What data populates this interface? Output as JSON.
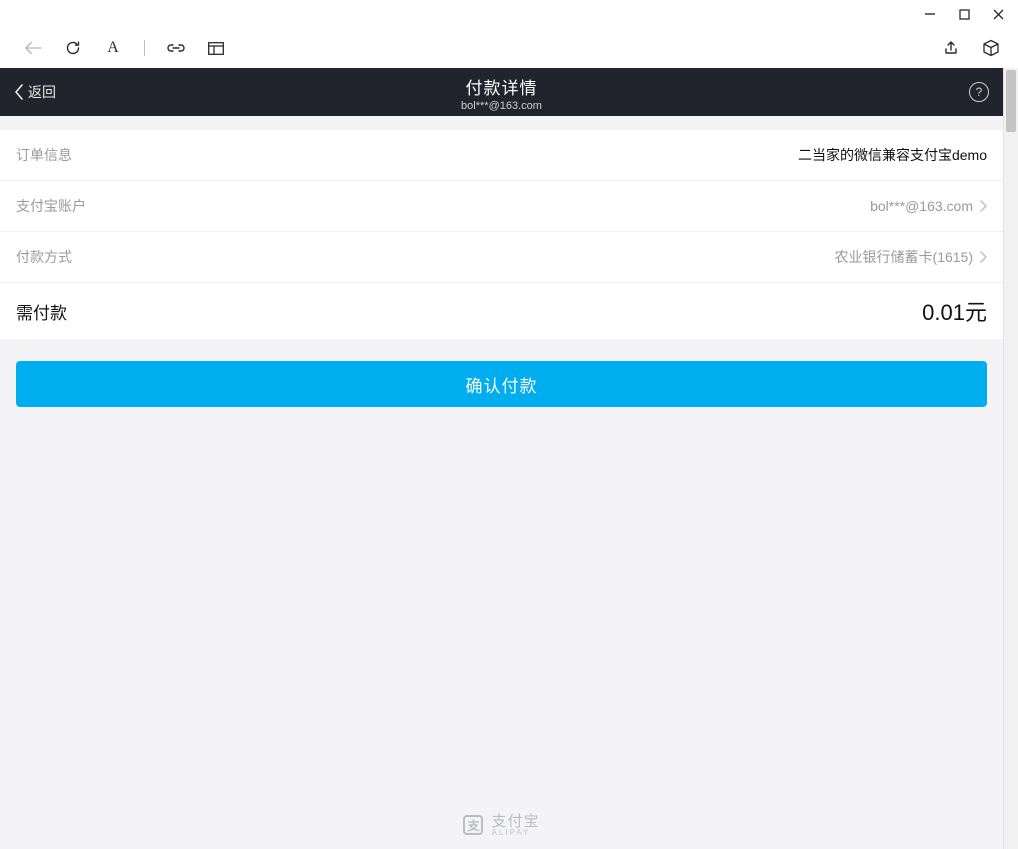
{
  "colors": {
    "accent": "#00aeef",
    "header_bg": "#21242d"
  },
  "browser": {
    "toolbar": {
      "back_icon": "back-arrow",
      "reload_icon": "reload",
      "text_icon_label": "A",
      "link_icon": "link",
      "layout_icon": "layout",
      "share_icon": "share",
      "cube_icon": "cube"
    }
  },
  "header": {
    "back_label": "返回",
    "title": "付款详情",
    "subtitle": "bol***@163.com"
  },
  "rows": {
    "order": {
      "label": "订单信息",
      "value": "二当家的微信兼容支付宝demo"
    },
    "account": {
      "label": "支付宝账户",
      "value": "bol***@163.com"
    },
    "method": {
      "label": "付款方式",
      "value": "农业银行储蓄卡(1615)"
    },
    "total": {
      "label": "需付款",
      "value": "0.01元"
    }
  },
  "confirm": {
    "label": "确认付款"
  },
  "footer": {
    "brand_cn": "支付宝",
    "brand_en": "ALIPAY"
  }
}
